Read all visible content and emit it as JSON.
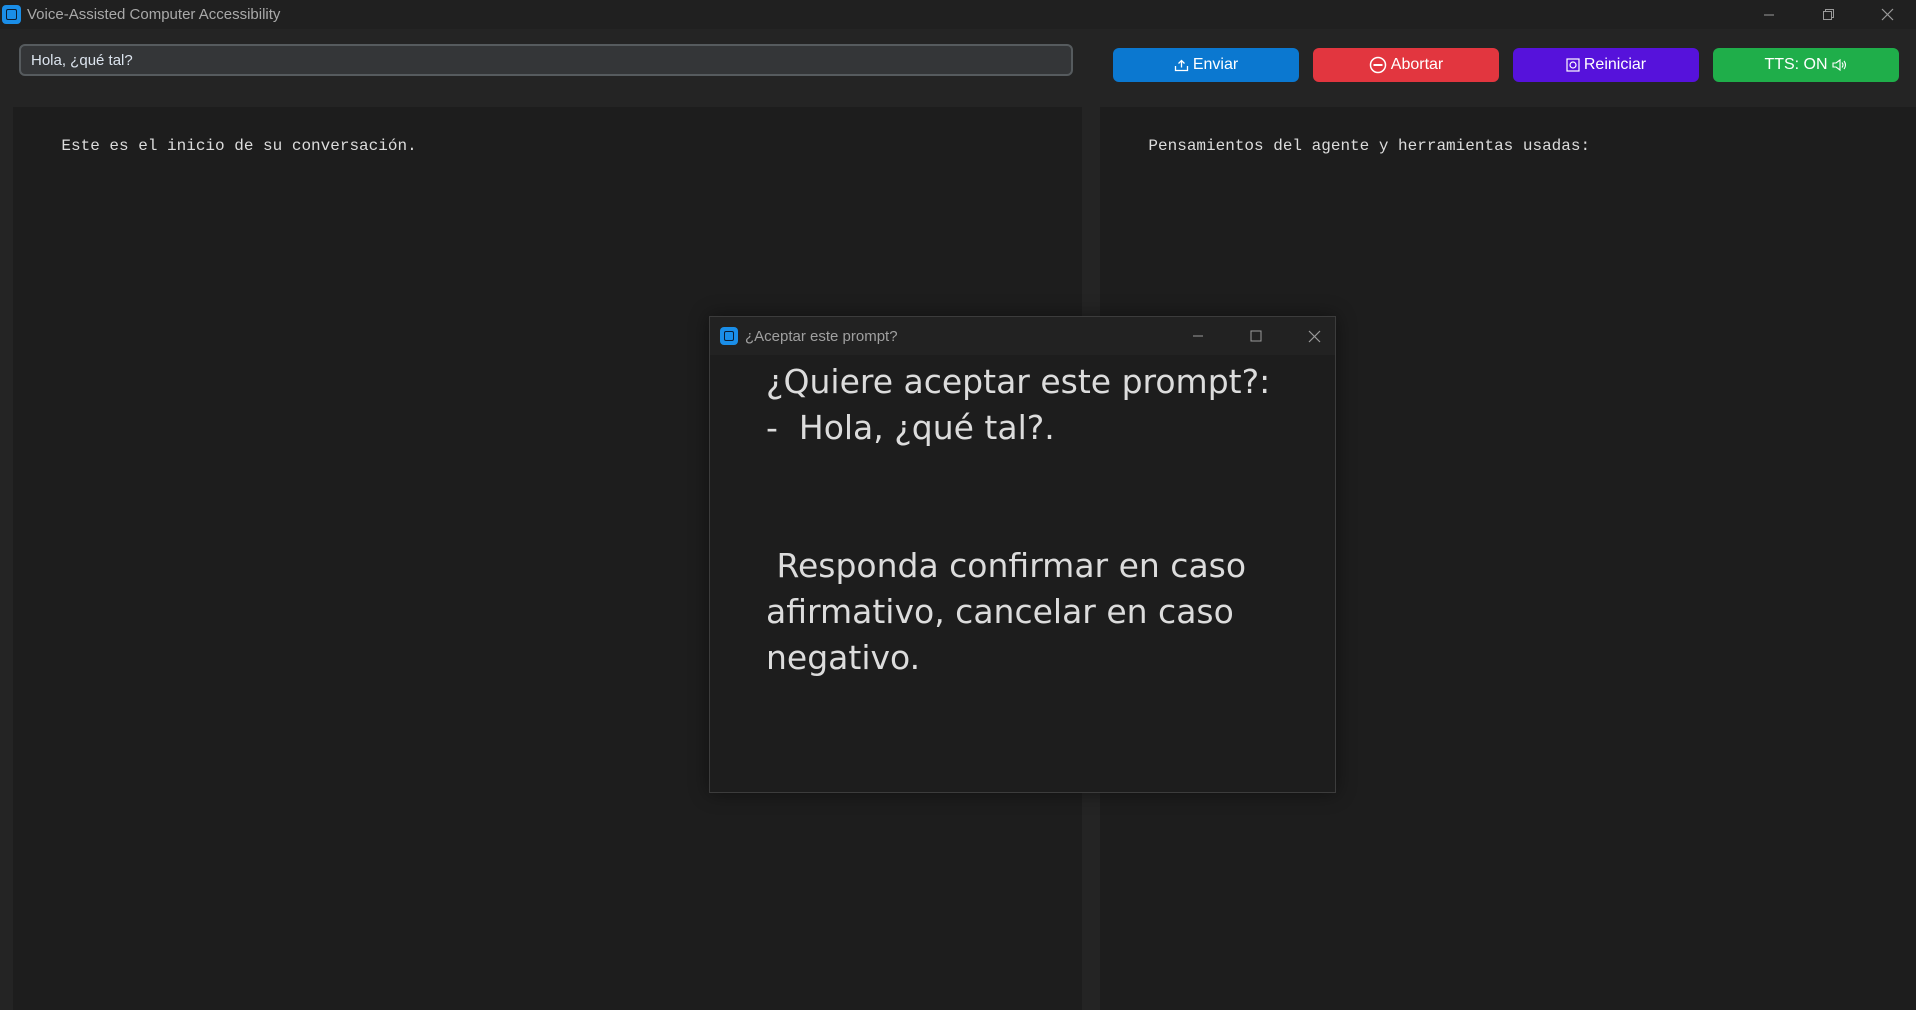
{
  "window": {
    "title": "Voice-Assisted Computer Accessibility"
  },
  "toolbar": {
    "prompt_value": "Hola, ¿qué tal?",
    "send_label": "Enviar",
    "abort_label": "Abortar",
    "reset_label": "Reiniciar",
    "tts_label": "TTS: ON"
  },
  "conversation": {
    "text": "Este es el inicio de su conversación."
  },
  "agent": {
    "text": "Pensamientos del agente y herramientas usadas:"
  },
  "dialog": {
    "title": "¿Aceptar este prompt?",
    "body": "¿Quiere aceptar este prompt?:\n-  Hola, ¿qué tal?.\n\n\n Responda confirmar en caso\nafirmativo, cancelar en caso\nnegativo."
  },
  "colors": {
    "send": "#0b78d0",
    "abort": "#e2363f",
    "reset": "#5612db",
    "tts": "#1fae4a",
    "logo": "#1a8ee8"
  },
  "icons": {
    "send": "upload-tray-icon",
    "abort": "no-entry-icon",
    "reset": "square-reset-icon",
    "tts": "speaker-icon"
  }
}
